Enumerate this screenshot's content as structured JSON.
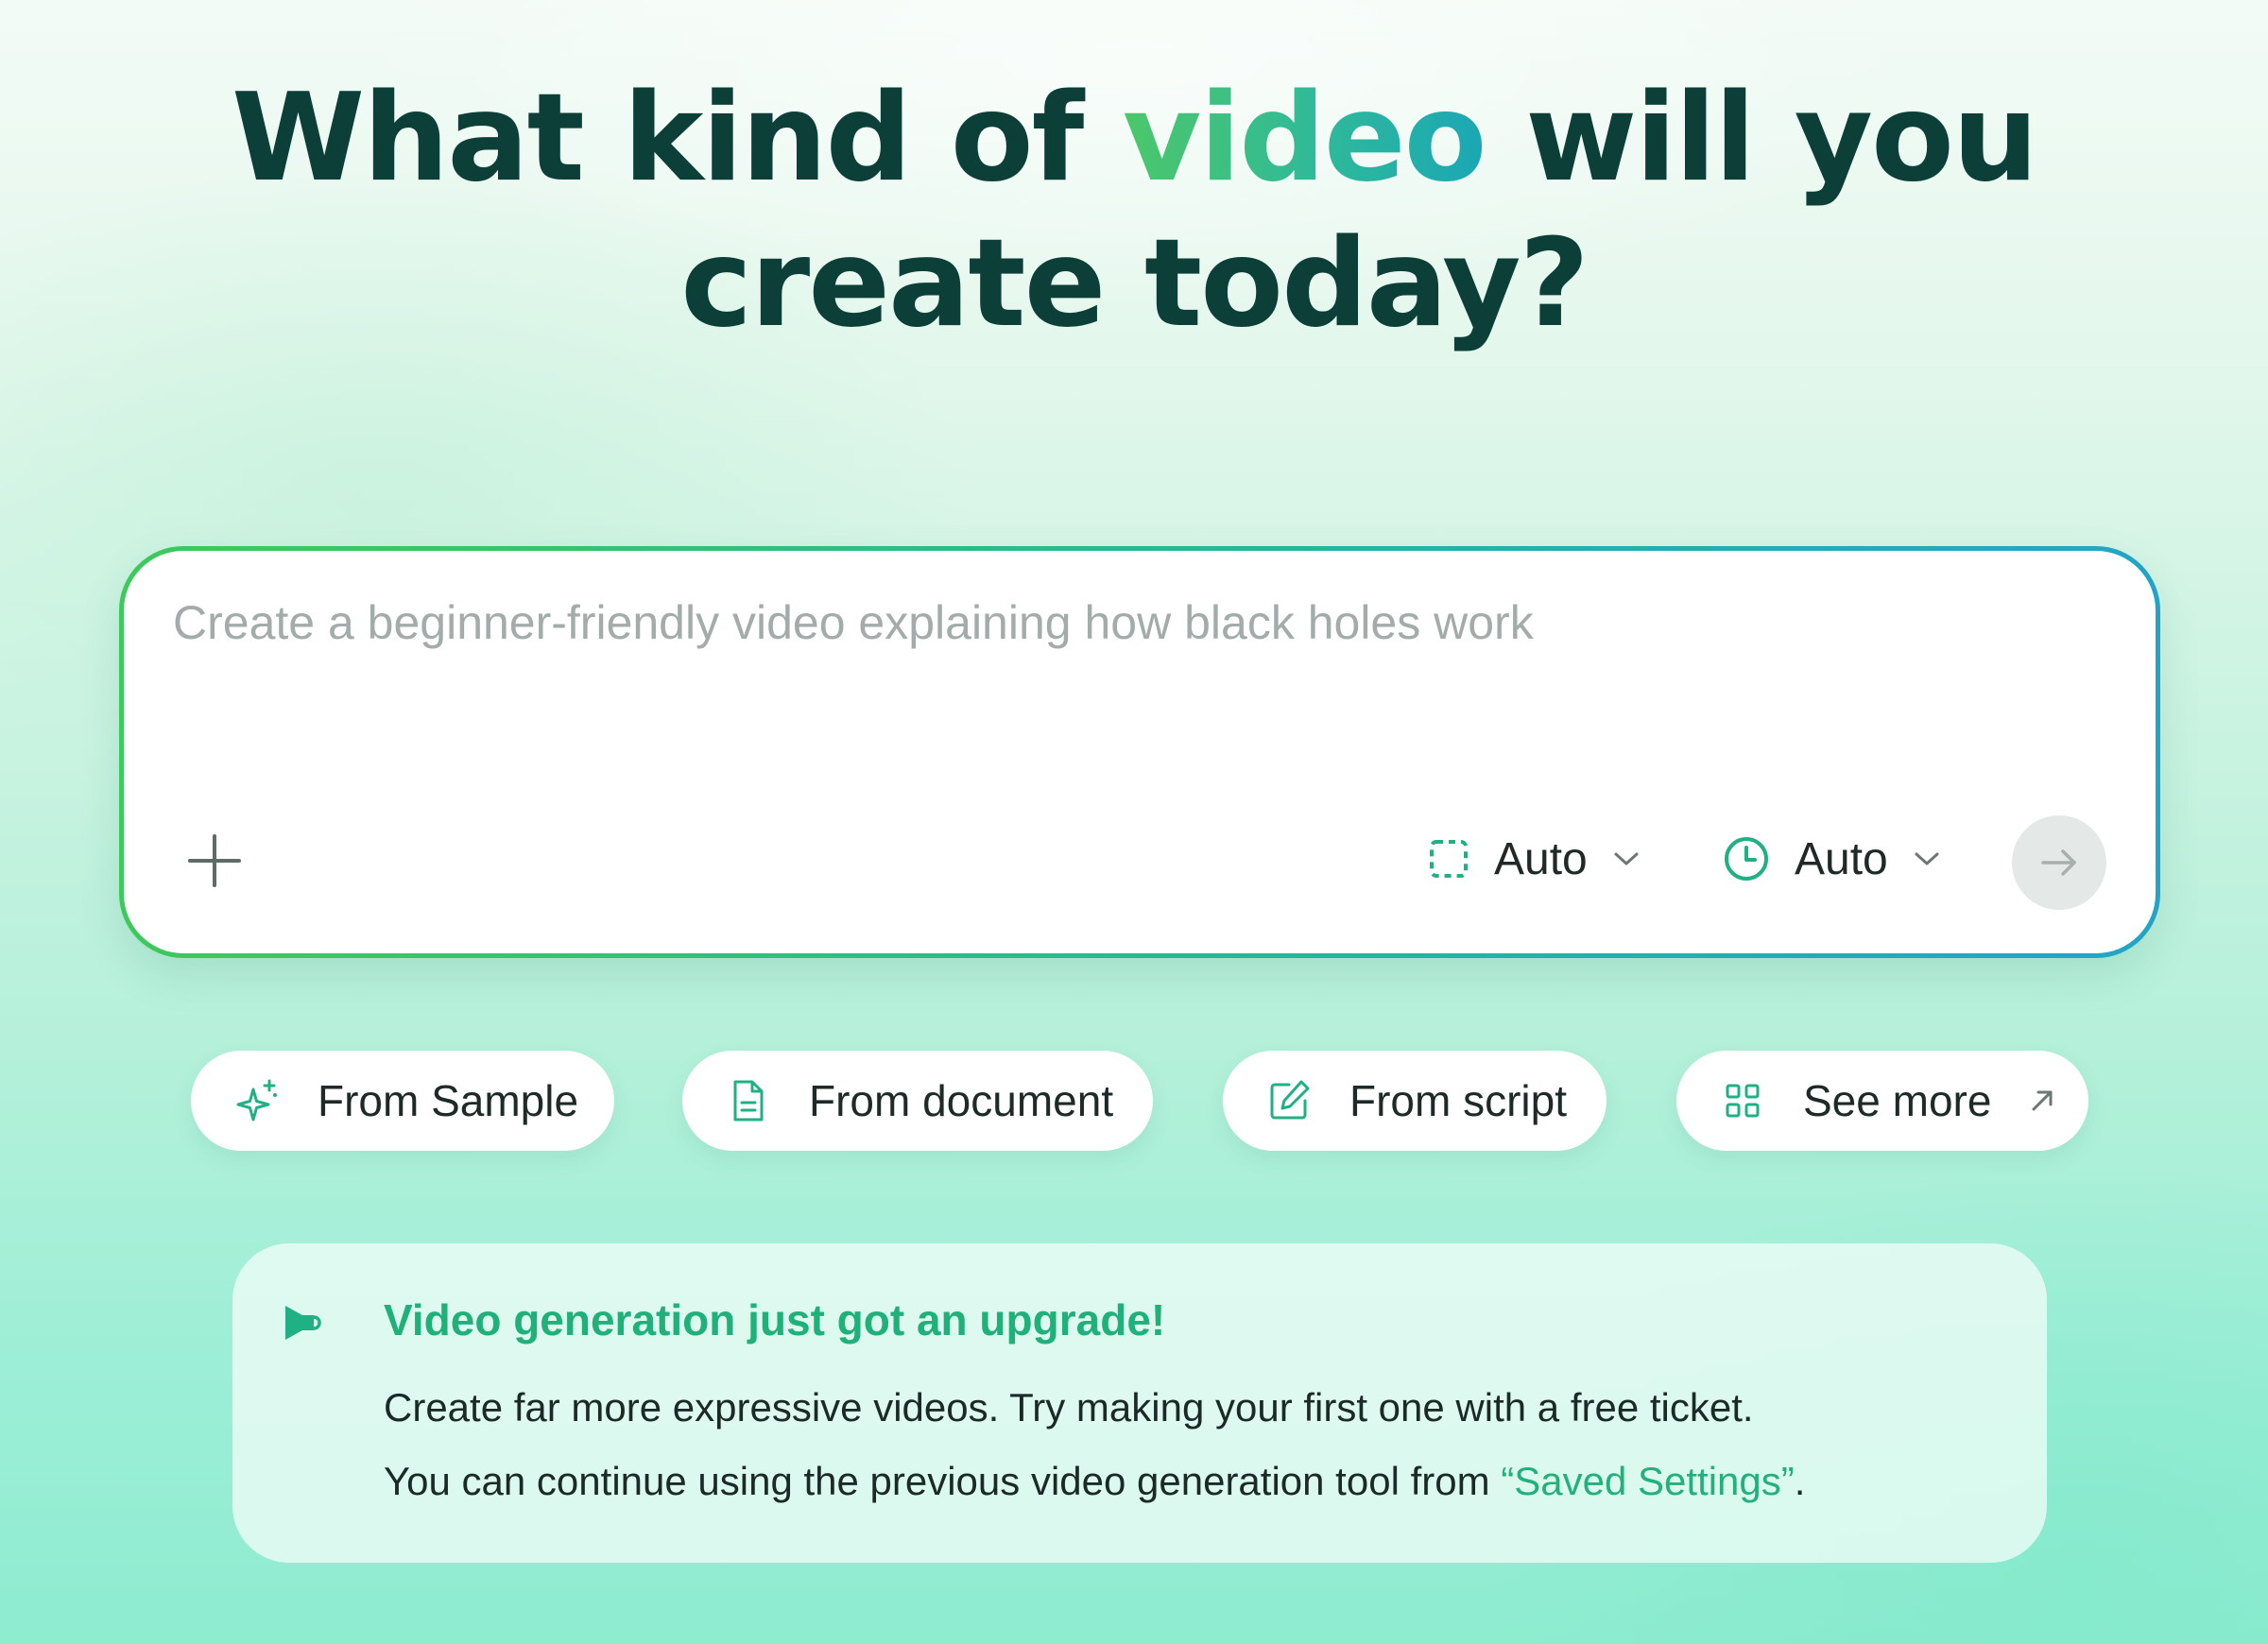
{
  "headline": {
    "before": "What kind of ",
    "accent": "video",
    "after": " will you create today?"
  },
  "prompt": {
    "placeholder": "Create a beginner-friendly video explaining how black holes work",
    "value": "",
    "aspect_label": "Auto",
    "duration_label": "Auto"
  },
  "chips": {
    "sample": "From Sample",
    "document": "From document",
    "script": "From script",
    "more": "See more"
  },
  "announcement": {
    "title": "Video generation just got an upgrade!",
    "line1": "Create far more expressive videos. Try making your first one with a free ticket.",
    "line2_before": "You can continue using the previous video generation tool from ",
    "link": "“Saved Settings”",
    "line2_after": "."
  },
  "colors": {
    "headline": "#0c3f38",
    "accent_start": "#4cc76a",
    "accent_end": "#1aa7b5",
    "brand_green": "#20b07a"
  },
  "icons": {
    "add": "plus-icon",
    "aspect": "dashed-square-icon",
    "duration": "clock-icon",
    "submit": "arrow-right-icon",
    "sample": "sparkles-icon",
    "document": "document-icon",
    "script": "edit-icon",
    "more": "grid-icon",
    "more_ext": "external-arrow-icon",
    "announce": "megaphone-icon"
  }
}
